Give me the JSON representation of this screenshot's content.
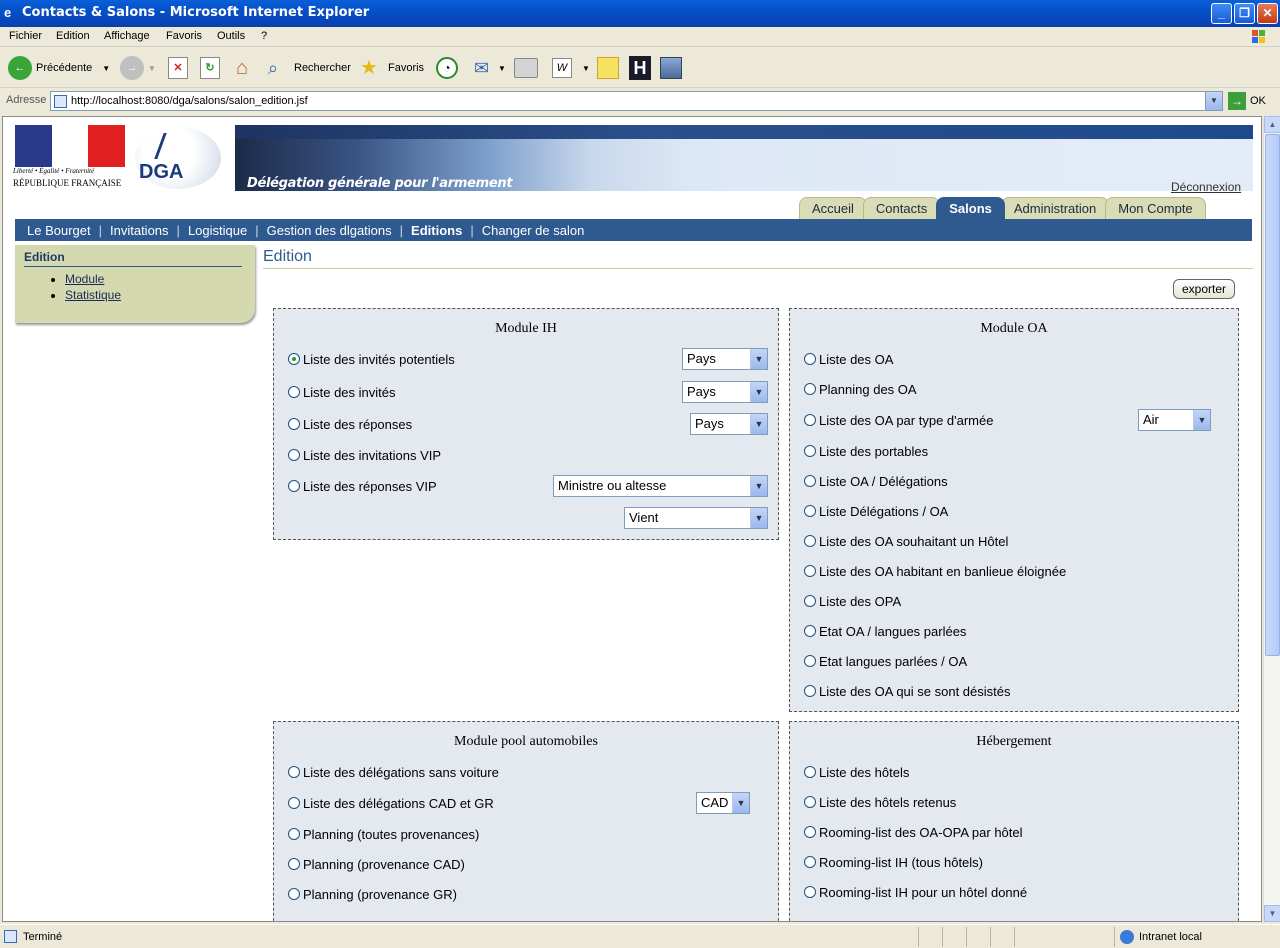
{
  "window": {
    "title": "Contacts & Salons - Microsoft Internet Explorer"
  },
  "menu": [
    "Fichier",
    "Edition",
    "Affichage",
    "Favoris",
    "Outils",
    "?"
  ],
  "toolbar": {
    "back": "Précédente",
    "search": "Rechercher",
    "favorites": "Favoris"
  },
  "address": {
    "label": "Adresse",
    "url": "http://localhost:8080/dga/salons/salon_edition.jsf",
    "go": "OK"
  },
  "banner": {
    "rf_line1": "Liberté • Égalité • Fraternité",
    "rf_line2": "RÉPUBLIQUE FRANÇAISE",
    "dga": "DGA",
    "caption": "Délégation générale pour l'armement"
  },
  "logout": "Déconnexion",
  "tabs": [
    {
      "label": "Accueil",
      "active": false
    },
    {
      "label": "Contacts",
      "active": false
    },
    {
      "label": "Salons",
      "active": true
    },
    {
      "label": "Administration",
      "active": false
    },
    {
      "label": "Mon Compte",
      "active": false
    }
  ],
  "nav": [
    "Le Bourget",
    "Invitations",
    "Logistique",
    "Gestion des dlgations",
    "Editions",
    "Changer de salon"
  ],
  "nav_current": "Editions",
  "sidebar": {
    "title": "Edition",
    "items": [
      "Module",
      "Statistique"
    ]
  },
  "main": {
    "title": "Edition",
    "export": "exporter"
  },
  "module_ih": {
    "title": "Module IH",
    "rows": [
      "Liste des invités potentiels",
      "Liste des invités",
      "Liste des réponses",
      "Liste des invitations VIP",
      "Liste des réponses VIP"
    ],
    "selects": [
      "Pays",
      "Pays",
      "Pays",
      "Ministre ou altesse",
      "Vient"
    ]
  },
  "module_oa": {
    "title": "Module OA",
    "rows": [
      "Liste des OA",
      "Planning des OA",
      "Liste des OA par type d'armée",
      "Liste des portables",
      "Liste OA / Délégations",
      "Liste Délégations / OA",
      "Liste des OA souhaitant un Hôtel",
      "Liste des OA habitant en banlieue éloignée",
      "Liste des OPA",
      "Etat OA / langues parlées",
      "Etat langues parlées / OA",
      "Liste des OA qui se sont désistés"
    ],
    "select": "Air"
  },
  "module_pool": {
    "title": "Module pool automobiles",
    "rows": [
      "Liste des délégations sans voiture",
      "Liste des délégations CAD et GR",
      "Planning (toutes provenances)",
      "Planning (provenance CAD)",
      "Planning (provenance GR)"
    ],
    "select": "CAD"
  },
  "hebergement": {
    "title": "Hébergement",
    "rows": [
      "Liste des hôtels",
      "Liste des hôtels retenus",
      "Rooming-list des OA-OPA par hôtel",
      "Rooming-list IH (tous hôtels)",
      "Rooming-list IH pour un hôtel donné"
    ]
  },
  "status": {
    "left": "Terminé",
    "zone": "Intranet local"
  },
  "colors": {
    "nav": "#2f5a8f",
    "sidebar": "#d5d9b0",
    "panel_bg": "#e4e8ef"
  }
}
